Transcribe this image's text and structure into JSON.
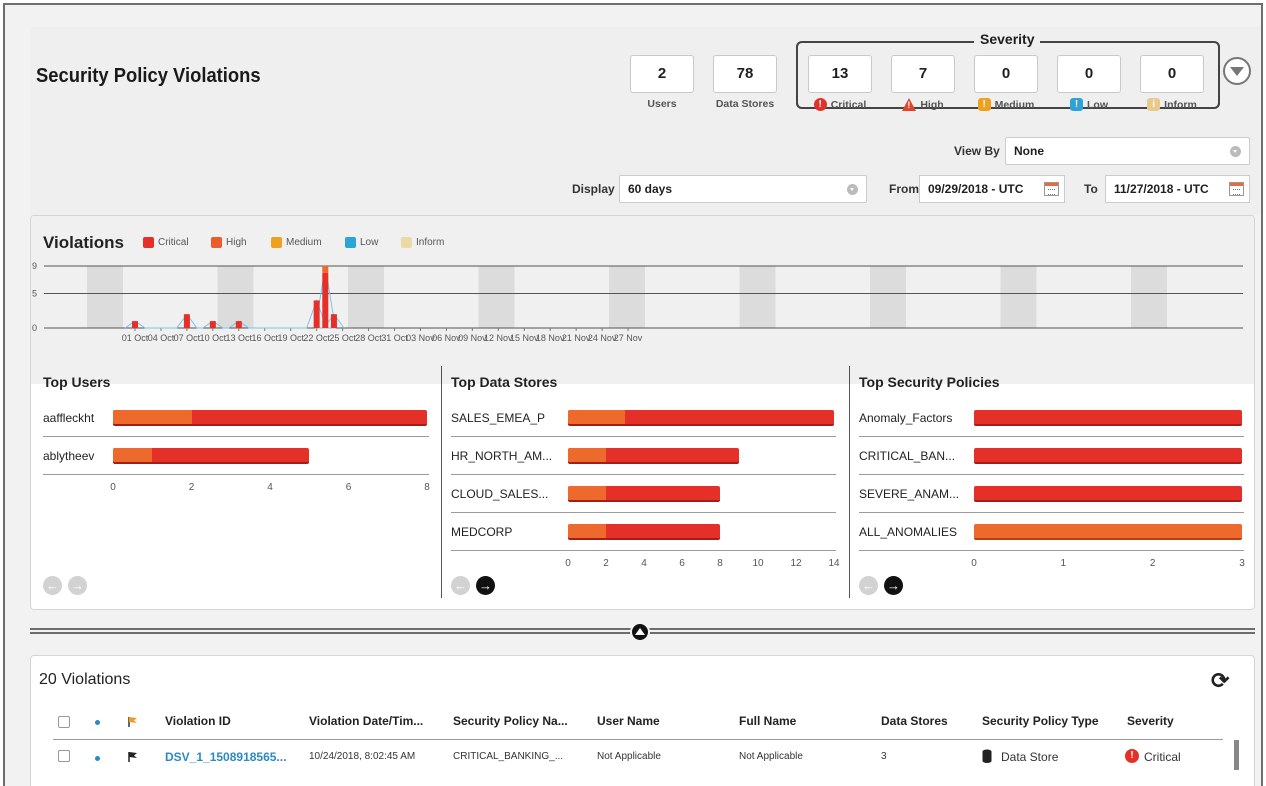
{
  "header": {
    "title": "Security Policy Violations",
    "severity_title": "Severity",
    "stats": [
      {
        "value": "2",
        "label": "Users"
      },
      {
        "value": "78",
        "label": "Data Stores"
      }
    ],
    "severities": [
      {
        "value": "13",
        "label": "Critical",
        "icon": "exclamation-icon",
        "color": "#e5302a"
      },
      {
        "value": "7",
        "label": "High",
        "icon": "warning-triangle-icon",
        "color": "#e0442b"
      },
      {
        "value": "0",
        "label": "Medium",
        "icon": "exclamation-icon",
        "color": "#f0a020"
      },
      {
        "value": "0",
        "label": "Low",
        "icon": "exclamation-icon",
        "color": "#2ea3d6"
      },
      {
        "value": "0",
        "label": "Inform",
        "icon": "info-icon",
        "color": "#e8c98e"
      }
    ]
  },
  "filters": {
    "view_by_label": "View By",
    "view_by_value": "None",
    "display_label": "Display",
    "display_value": "60 days",
    "from_label": "From",
    "from_value": "09/29/2018 - UTC",
    "to_label": "To",
    "to_value": "11/27/2018 - UTC"
  },
  "violations_chart": {
    "title": "Violations",
    "legend": [
      {
        "label": "Critical",
        "color": "#e5302a"
      },
      {
        "label": "High",
        "color": "#ed5a2c"
      },
      {
        "label": "Medium",
        "color": "#f0a020"
      },
      {
        "label": "Low",
        "color": "#2ea3d6"
      },
      {
        "label": "Inform",
        "color": "#ecd9a8"
      }
    ]
  },
  "chart_data": [
    {
      "type": "bar",
      "title": "Violations",
      "y_ticks": [
        "0",
        "5",
        "9"
      ],
      "ylim": [
        0,
        9
      ],
      "x_tick_labels": [
        "01 Oct",
        "04 Oct",
        "07 Oct",
        "10 Oct",
        "13 Oct",
        "16 Oct",
        "19 Oct",
        "22 Oct",
        "25 Oct",
        "28 Oct",
        "31 Oct",
        "03 Nov",
        "06 Nov",
        "09 Nov",
        "12 Nov",
        "15 Nov",
        "18 Nov",
        "21 Nov",
        "24 Nov",
        "27 Nov"
      ],
      "series": [
        {
          "name": "Critical",
          "points": [
            {
              "date": "01 Oct",
              "value": 1
            },
            {
              "date": "07 Oct",
              "value": 2
            },
            {
              "date": "10 Oct",
              "value": 1
            },
            {
              "date": "13 Oct",
              "value": 1
            },
            {
              "date": "22 Oct",
              "value": 4
            },
            {
              "date": "23 Oct",
              "value": 8
            },
            {
              "date": "24 Oct",
              "value": 2
            }
          ]
        },
        {
          "name": "High",
          "points": [
            {
              "date": "23 Oct",
              "value": 1
            }
          ]
        }
      ]
    },
    {
      "type": "bar",
      "title": "Top Users",
      "orientation": "horizontal",
      "categories": [
        "aaffleckht",
        "ablytheev"
      ],
      "series": [
        {
          "name": "High",
          "values": [
            2,
            1
          ]
        },
        {
          "name": "Critical",
          "values": [
            6,
            4
          ]
        }
      ],
      "xlim": [
        0,
        8
      ],
      "ticks": [
        "0",
        "2",
        "4",
        "6",
        "8"
      ]
    },
    {
      "type": "bar",
      "title": "Top Data Stores",
      "orientation": "horizontal",
      "categories": [
        "SALES_EMEA_P",
        "HR_NORTH_AM...",
        "CLOUD_SALES...",
        "MEDCORP"
      ],
      "series": [
        {
          "name": "High",
          "values": [
            3,
            2,
            2,
            2
          ]
        },
        {
          "name": "Critical",
          "values": [
            11,
            7,
            6,
            6
          ]
        }
      ],
      "xlim": [
        0,
        14
      ],
      "ticks": [
        "0",
        "2",
        "4",
        "6",
        "8",
        "10",
        "12",
        "14"
      ]
    },
    {
      "type": "bar",
      "title": "Top Security Policies",
      "orientation": "horizontal",
      "categories": [
        "Anomaly_Factors",
        "CRITICAL_BAN...",
        "SEVERE_ANAM...",
        "ALL_ANOMALIES"
      ],
      "series": [
        {
          "name": "Critical",
          "values": [
            3,
            3,
            3,
            0
          ]
        },
        {
          "name": "High",
          "values": [
            0,
            0,
            0,
            3
          ]
        }
      ],
      "xlim": [
        0,
        3
      ],
      "ticks": [
        "0",
        "1",
        "2",
        "3"
      ]
    }
  ],
  "table": {
    "count_label": "20 Violations",
    "columns": [
      "Violation ID",
      "Violation Date/Tim...",
      "Security Policy Na...",
      "User Name",
      "Full Name",
      "Data Stores",
      "Security Policy Type",
      "Severity"
    ],
    "rows": [
      {
        "violation_id": "DSV_1_1508918565...",
        "date": "10/24/2018, 8:02:45 AM",
        "policy": "CRITICAL_BANKING_...",
        "user": "Not Applicable",
        "full_name": "Not Applicable",
        "data_stores": "3",
        "policy_type": "Data Store",
        "severity": "Critical"
      }
    ]
  }
}
